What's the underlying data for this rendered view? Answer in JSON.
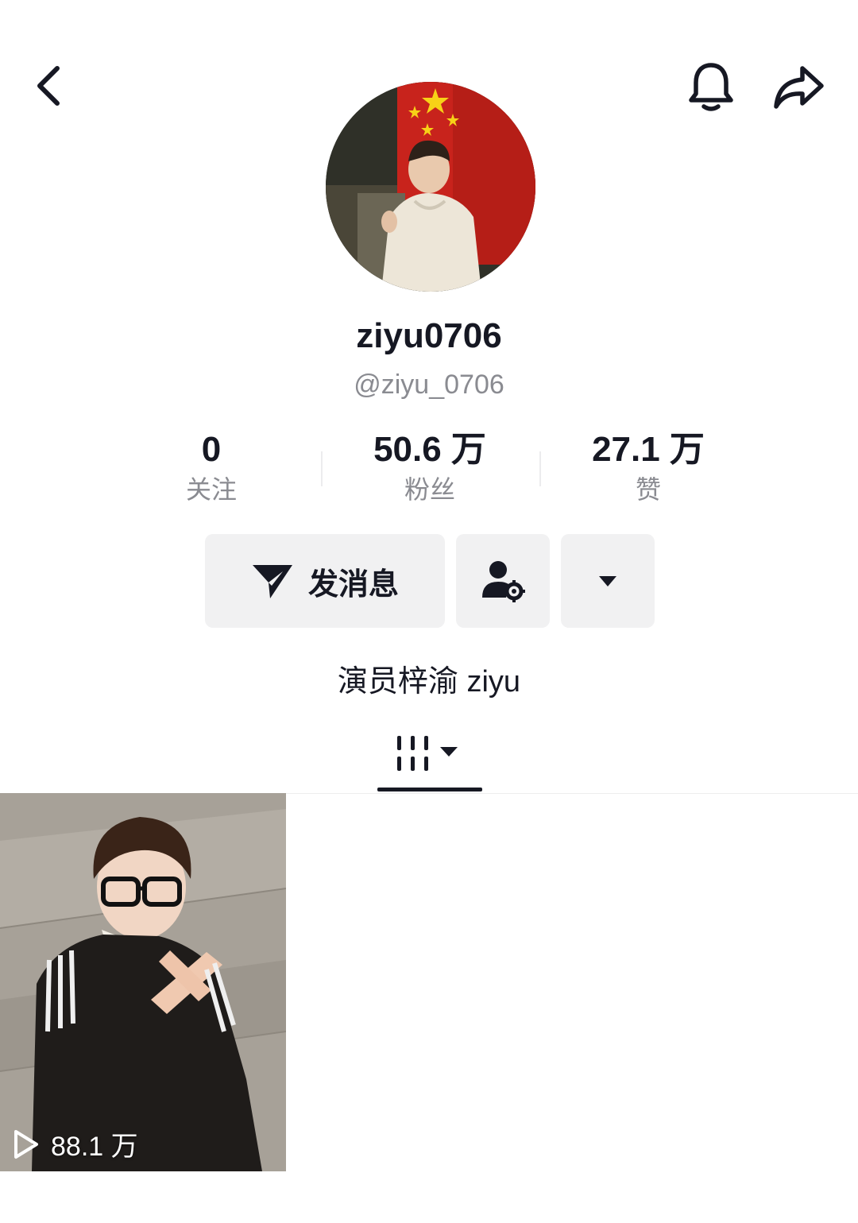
{
  "profile": {
    "display_name": "ziyu0706",
    "handle": "@ziyu_0706",
    "bio": "演员梓渝 ziyu"
  },
  "stats": {
    "following": {
      "value": "0",
      "label": "关注"
    },
    "followers": {
      "value": "50.6 万",
      "label": "粉丝"
    },
    "likes": {
      "value": "27.1 万",
      "label": "赞"
    }
  },
  "actions": {
    "message_label": "发消息"
  },
  "videos": [
    {
      "views": "88.1 万"
    }
  ],
  "colors": {
    "text_primary": "#161823",
    "text_secondary": "#8a8b91",
    "button_bg": "#f1f1f2"
  },
  "icons": {
    "back": "chevron-left-icon",
    "notifications": "bell-icon",
    "share": "share-arrow-icon",
    "message": "paper-plane-icon",
    "user_settings": "user-gear-icon",
    "more": "caret-down-icon",
    "works_tab": "grid-bars-icon",
    "play": "play-outline-icon"
  }
}
